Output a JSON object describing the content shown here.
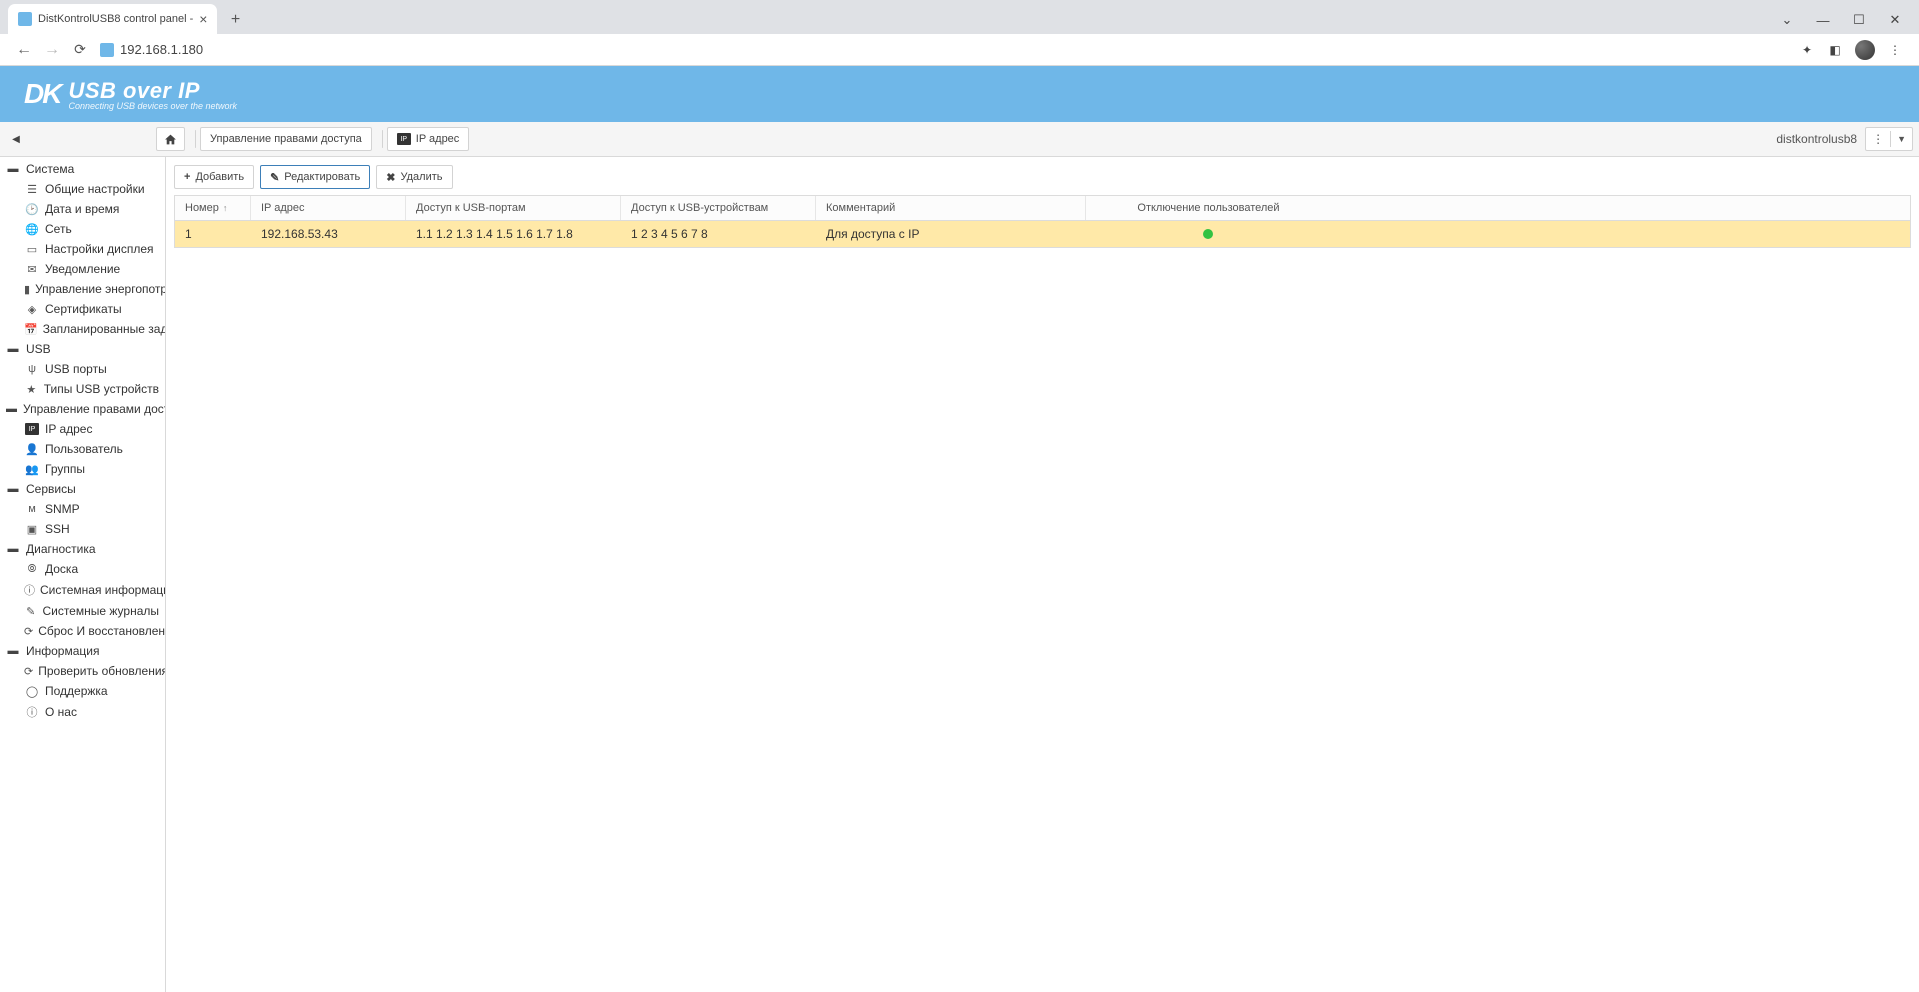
{
  "browser": {
    "tab_title": "DistKontrolUSB8 control panel - ",
    "url": "192.168.1.180"
  },
  "brand": {
    "mark": "DK",
    "title": "USB over IP",
    "subtitle": "Connecting USB devices over the network"
  },
  "toolbar": {
    "breadcrumb1": "Управление правами доступа",
    "breadcrumb2": "IP адрес",
    "username": "distkontrolusb8"
  },
  "actions": {
    "add": "Добавить",
    "edit": "Редактировать",
    "delete": "Удалить"
  },
  "columns": {
    "number": "Номер",
    "ip": "IP адрес",
    "usb_ports": "Доступ к USB-портам",
    "usb_devices": "Доступ к USB-устройствам",
    "comment": "Комментарий",
    "disconnect": "Отключение пользователей"
  },
  "row": {
    "number": "1",
    "ip": "192.168.53.43",
    "usb_ports": "1.1 1.2 1.3 1.4 1.5 1.6 1.7 1.8",
    "usb_devices": "1 2 3 4 5 6 7 8",
    "comment": "Для доступа с IP"
  },
  "side": {
    "system": "Система",
    "general": "Общие настройки",
    "datetime": "Дата и время",
    "network": "Сеть",
    "display": "Настройки дисплея",
    "notify": "Уведомление",
    "power": "Управление энергопотр",
    "certs": "Сертификаты",
    "sched": "Запланированные задан",
    "usb": "USB",
    "usb_ports": "USB порты",
    "usb_types": "Типы USB устройств",
    "access": "Управление правами досту",
    "ipaddr": "IP адрес",
    "user": "Пользователь",
    "groups": "Группы",
    "services": "Сервисы",
    "snmp": "SNMP",
    "ssh": "SSH",
    "diag": "Диагностика",
    "board": "Доска",
    "sysinfo": "Системная информация",
    "syslog": "Системные журналы",
    "reset": "Сброс И восстановление",
    "info": "Информация",
    "updates": "Проверить обновления",
    "support": "Поддержка",
    "about": "О нас"
  }
}
